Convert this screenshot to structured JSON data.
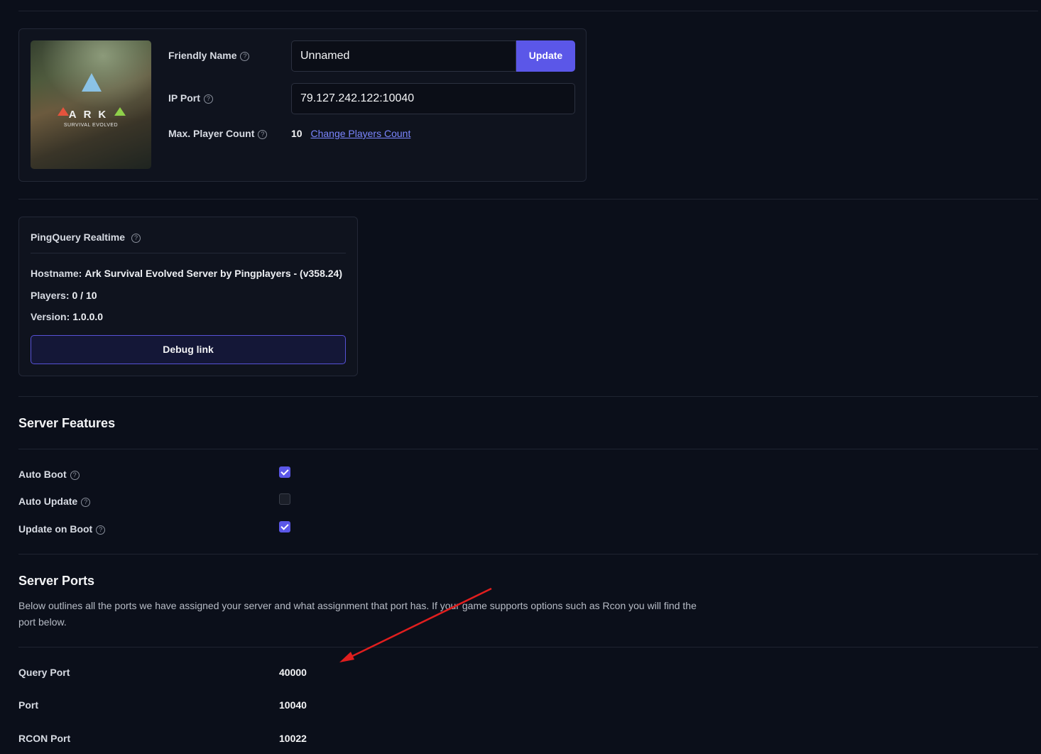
{
  "server_card": {
    "friendly_name_label": "Friendly Name",
    "friendly_name_value": "Unnamed",
    "update_label": "Update",
    "ip_port_label": "IP Port",
    "ip_port_value": "79.127.242.122:10040",
    "max_player_label": "Max. Player Count",
    "max_player_value": "10",
    "change_players_label": "Change Players Count",
    "cover_title": "ARK",
    "cover_subtitle": "SURVIVAL EVOLVED"
  },
  "ping_query": {
    "title": "PingQuery Realtime",
    "hostname_label": "Hostname:",
    "hostname_value": "Ark Survival Evolved Server by Pingplayers - (v358.24)",
    "players_label": "Players:",
    "players_value": "0 / 10",
    "version_label": "Version:",
    "version_value": "1.0.0.0",
    "debug_label": "Debug link"
  },
  "features": {
    "title": "Server Features",
    "items": [
      {
        "label": "Auto Boot",
        "checked": true
      },
      {
        "label": "Auto Update",
        "checked": false
      },
      {
        "label": "Update on Boot",
        "checked": true
      }
    ]
  },
  "ports": {
    "title": "Server Ports",
    "description": "Below outlines all the ports we have assigned your server and what assignment that port has. If your game supports options such as Rcon you will find the port below.",
    "rows": [
      {
        "name": "Query Port",
        "value": "40000"
      },
      {
        "name": "Port",
        "value": "10040"
      },
      {
        "name": "RCON Port",
        "value": "10022"
      }
    ]
  },
  "colors": {
    "accent": "#5b57e8",
    "annotation_arrow": "#e01e1e"
  },
  "icons": {
    "help": "help-circle-icon",
    "check": "check-icon"
  }
}
